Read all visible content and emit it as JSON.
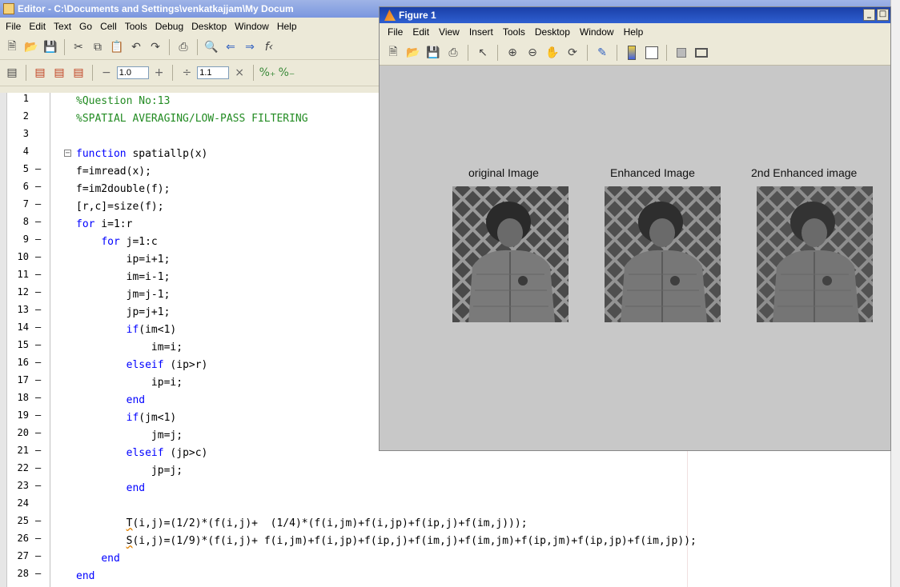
{
  "editor": {
    "title": "Editor - C:\\Documents and Settings\\venkatkajjam\\My Docum",
    "menu": [
      "File",
      "Edit",
      "Text",
      "Go",
      "Cell",
      "Tools",
      "Debug",
      "Desktop",
      "Window",
      "Help"
    ],
    "cell_toolbar": {
      "minus": "−",
      "value1": "1.0",
      "plus": "+",
      "divide": "÷",
      "value2": "1.1",
      "times": "×"
    },
    "lines": [
      {
        "n": "1",
        "dash": "",
        "text": "%Question No:13"
      },
      {
        "n": "2",
        "dash": "",
        "text": "%SPATIAL AVERAGING/LOW-PASS FILTERING"
      },
      {
        "n": "3",
        "dash": "",
        "text": ""
      },
      {
        "n": "4",
        "dash": "",
        "text": "function spatiallp(x)"
      },
      {
        "n": "5",
        "dash": "—",
        "text": "f=imread(x);"
      },
      {
        "n": "6",
        "dash": "—",
        "text": "f=im2double(f);"
      },
      {
        "n": "7",
        "dash": "—",
        "text": "[r,c]=size(f);"
      },
      {
        "n": "8",
        "dash": "—",
        "text": "for i=1:r"
      },
      {
        "n": "9",
        "dash": "—",
        "text": "    for j=1:c"
      },
      {
        "n": "10",
        "dash": "—",
        "text": "        ip=i+1;"
      },
      {
        "n": "11",
        "dash": "—",
        "text": "        im=i-1;"
      },
      {
        "n": "12",
        "dash": "—",
        "text": "        jm=j-1;"
      },
      {
        "n": "13",
        "dash": "—",
        "text": "        jp=j+1;"
      },
      {
        "n": "14",
        "dash": "—",
        "text": "        if(im<1)"
      },
      {
        "n": "15",
        "dash": "—",
        "text": "            im=i;"
      },
      {
        "n": "16",
        "dash": "—",
        "text": "        elseif (ip>r)"
      },
      {
        "n": "17",
        "dash": "—",
        "text": "            ip=i;"
      },
      {
        "n": "18",
        "dash": "—",
        "text": "        end"
      },
      {
        "n": "19",
        "dash": "—",
        "text": "        if(jm<1)"
      },
      {
        "n": "20",
        "dash": "—",
        "text": "            jm=j;"
      },
      {
        "n": "21",
        "dash": "—",
        "text": "        elseif (jp>c)"
      },
      {
        "n": "22",
        "dash": "—",
        "text": "            jp=j;"
      },
      {
        "n": "23",
        "dash": "—",
        "text": "        end"
      },
      {
        "n": "24",
        "dash": "",
        "text": ""
      },
      {
        "n": "25",
        "dash": "—",
        "text": "        T(i,j)=(1/2)*(f(i,j)+  (1/4)*(f(i,jm)+f(i,jp)+f(ip,j)+f(im,j)));"
      },
      {
        "n": "26",
        "dash": "—",
        "text": "        S(i,j)=(1/9)*(f(i,j)+ f(i,jm)+f(i,jp)+f(ip,j)+f(im,j)+f(im,jm)+f(ip,jm)+f(ip,jp)+f(im,jp));"
      },
      {
        "n": "27",
        "dash": "—",
        "text": "    end"
      },
      {
        "n": "28",
        "dash": "—",
        "text": "end"
      }
    ]
  },
  "figure": {
    "title": "Figure 1",
    "window_buttons": [
      "_",
      "□"
    ],
    "menu": [
      "File",
      "Edit",
      "View",
      "Insert",
      "Tools",
      "Desktop",
      "Window",
      "Help"
    ],
    "axes_titles": [
      "original Image",
      "Enhanced  Image",
      "2nd Enhanced image"
    ]
  },
  "colors": {
    "comment": "#228b22",
    "keyword": "#0000ff",
    "figure_background": "#c8c8c8",
    "editor_titlebar": "#7a96df",
    "figure_titlebar": "#1a3fa8"
  }
}
